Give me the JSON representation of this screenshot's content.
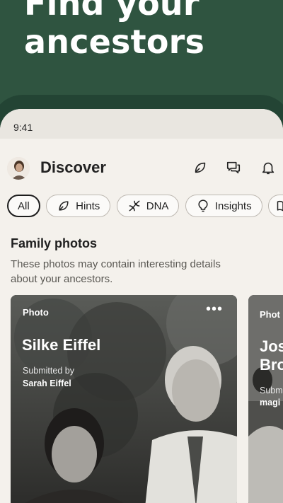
{
  "hero": {
    "line1": "Find your",
    "line2": "ancestors"
  },
  "status": {
    "time": "9:41"
  },
  "header": {
    "title": "Discover",
    "icons": [
      "hints-leaf-icon",
      "chat-icon",
      "bell-icon"
    ]
  },
  "filters": [
    {
      "label": "All",
      "active": true
    },
    {
      "label": "Hints",
      "icon": "leaf-icon"
    },
    {
      "label": "DNA",
      "icon": "dna-icon"
    },
    {
      "label": "Insights",
      "icon": "lightbulb-icon"
    }
  ],
  "section": {
    "title": "Family photos",
    "description": "These photos may contain interesting details about your ancestors."
  },
  "cards": [
    {
      "label": "Photo",
      "name": "Silke Eiffel",
      "submitted_label": "Submitted by",
      "submitted_by": "Sarah Eiffel",
      "more": "•••"
    },
    {
      "label": "Phot",
      "name_line1": "Jos",
      "name_line2": "Bro",
      "submitted_label": "Subm",
      "submitted_by": "magi"
    }
  ],
  "colors": {
    "brand_green": "#2f5440",
    "app_bg": "#f4f1ec"
  }
}
